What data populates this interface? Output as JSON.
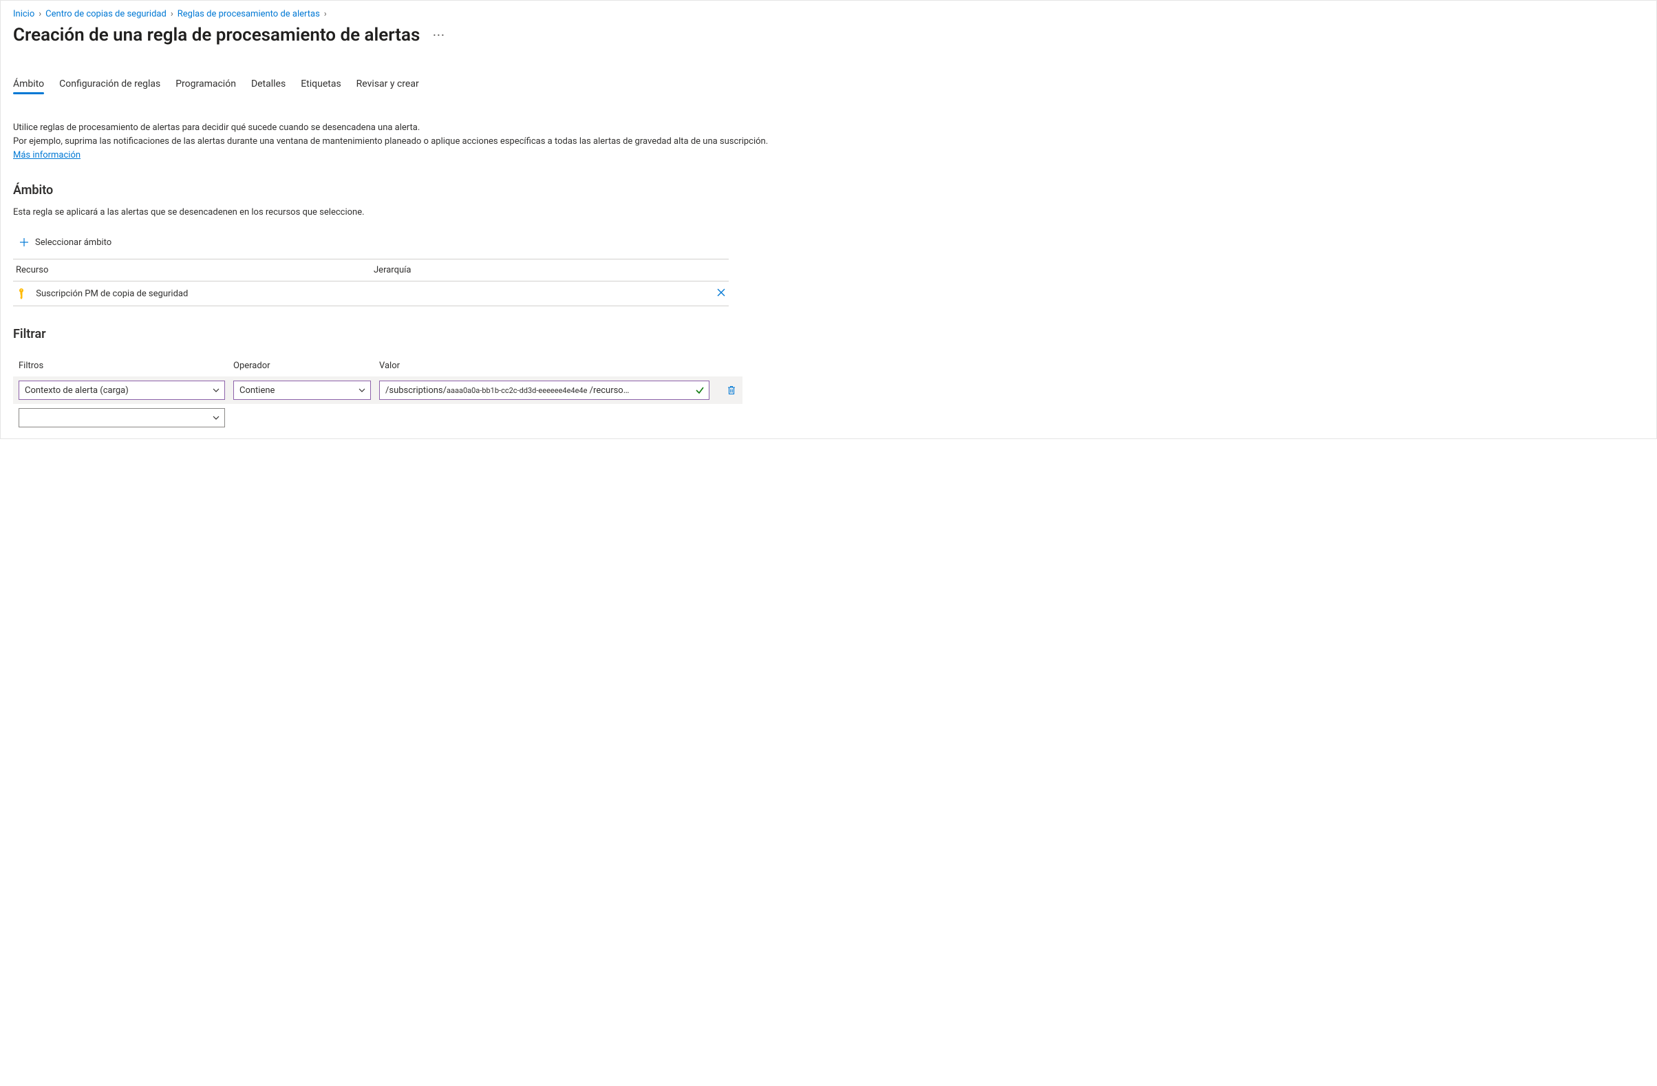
{
  "breadcrumb": {
    "items": [
      "Inicio",
      "Centro de copias de seguridad",
      "Reglas de procesamiento de alertas"
    ]
  },
  "title": "Creación de una regla de procesamiento de alertas",
  "tabs": {
    "items": [
      "Ámbito",
      "Configuración de reglas",
      "Programación",
      "Detalles",
      "Etiquetas",
      "Revisar y crear"
    ],
    "active": 0
  },
  "description": {
    "line1": "Utilice reglas de procesamiento de alertas para decidir qué sucede cuando se desencadena una alerta.",
    "line2a": "Por ejemplo, suprima las notificaciones de las alertas durante una ventana de mantenimiento planeado o aplique acciones específicas a todas las alertas de gravedad alta de una suscripción. ",
    "link": "Más información"
  },
  "scope": {
    "heading": "Ámbito",
    "subdesc": "Esta regla se aplicará a las alertas que se desencadenen en los recursos que seleccione.",
    "select_label": "Seleccionar ámbito",
    "table": {
      "col_resource": "Recurso",
      "col_hierarchy": "Jerarquía",
      "rows": [
        {
          "name": "Suscripción PM de copia de seguridad"
        }
      ]
    }
  },
  "filter": {
    "heading": "Filtrar",
    "col_filters": "Filtros",
    "col_operator": "Operador",
    "col_value": "Valor",
    "rows": [
      {
        "filter": "Contexto de alerta (carga)",
        "operator": "Contiene",
        "value_prefix": "/subscriptions/",
        "value_small": "aaaa0a0a-bb1b-cc2c-dd3d-eeeeee4e4e4e",
        "value_suffix": " /recurso…"
      }
    ],
    "empty_selector": ""
  }
}
